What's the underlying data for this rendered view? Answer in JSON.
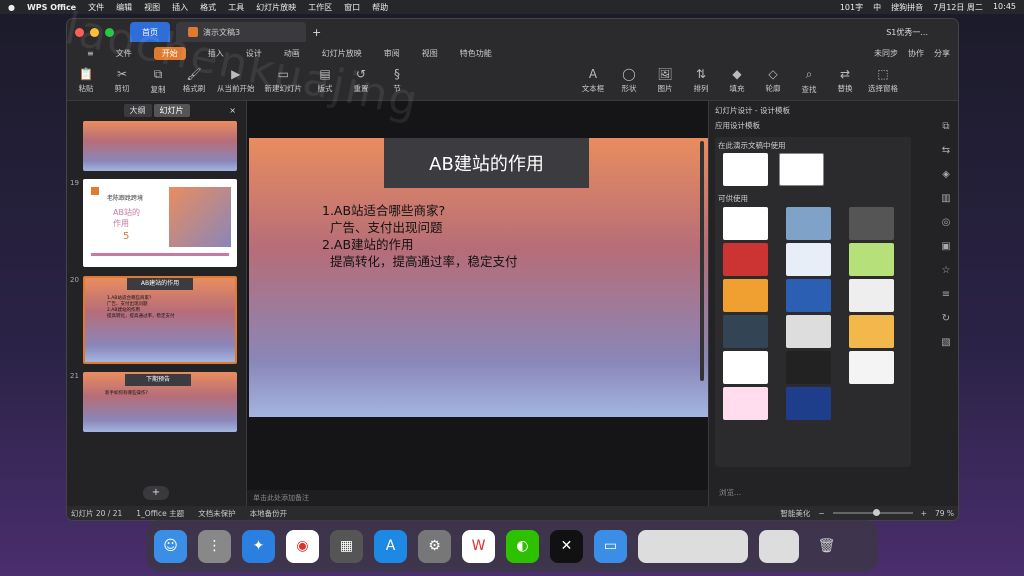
{
  "menubar": {
    "apple": "",
    "app": "WPS Office",
    "items": [
      "文件",
      "编辑",
      "视图",
      "插入",
      "格式",
      "工具",
      "幻灯片放映",
      "工作区",
      "窗口",
      "帮助"
    ],
    "right": [
      "101字",
      "中",
      "搜狗拼音",
      "7月12日 周二",
      "10:45"
    ]
  },
  "window": {
    "home_tab": "首页",
    "doc_tab": "演示文稿3",
    "plus": "+",
    "account": "S1优秀一..."
  },
  "ribbon": {
    "file": "文件",
    "tabs": [
      "开始",
      "插入",
      "设计",
      "动画",
      "幻灯片放映",
      "审阅",
      "视图",
      "特色功能"
    ],
    "active": "开始",
    "right": [
      "未同步",
      "协作",
      "分享"
    ]
  },
  "toolbar": {
    "items": [
      "粘贴",
      "剪切",
      "复制",
      "格式刷",
      "从当前开始",
      "新建幻灯片",
      "版式",
      "重置",
      "节",
      "文本框",
      "形状",
      "图片",
      "排列",
      "填充",
      "轮廓",
      "查找",
      "替换",
      "选择窗格"
    ]
  },
  "thumbs": {
    "tabs": [
      "大纲",
      "幻灯片"
    ],
    "active": "幻灯片",
    "close": "×",
    "slides": [
      {
        "num": "19",
        "title": "老陈踉跄跨境",
        "sub": "AB站的作用",
        "n": "5"
      },
      {
        "num": "20",
        "title": "AB建站的作用",
        "lines": [
          "1.AB站适合哪些商家?",
          "广告、支付出现问题",
          "2.AB建站的作用",
          "提高转化，提高通过率，稳定支付"
        ]
      },
      {
        "num": "21",
        "title": "下期预告",
        "lines": [
          "新手如何有哪些操作?"
        ]
      }
    ],
    "add": "+"
  },
  "slide": {
    "title": "AB建站的作用",
    "lines": [
      "1.AB站适合哪些商家?",
      "  广告、支付出现问题",
      "2.AB建站的作用",
      "  提高转化，提高通过率，稳定支付"
    ]
  },
  "notes": "单击此处添加备注",
  "side": {
    "title": "幻灯片设计 - 设计模板",
    "sub": "应用设计模板",
    "in_use": "在此演示文稿中使用",
    "available": "可供使用",
    "browse": "浏览..."
  },
  "status": {
    "slide": "幻灯片 20 / 21",
    "theme": "1_Office 主题",
    "protect": "文档未保护",
    "backup": "本地备份开",
    "beautify": "智能美化",
    "zoom": "79 %",
    "plus": "+",
    "minus": "−"
  },
  "watermark": "laochenkuajing",
  "colors": {
    "accent": "#e07a2e",
    "home_tab": "#2f6ed8"
  }
}
